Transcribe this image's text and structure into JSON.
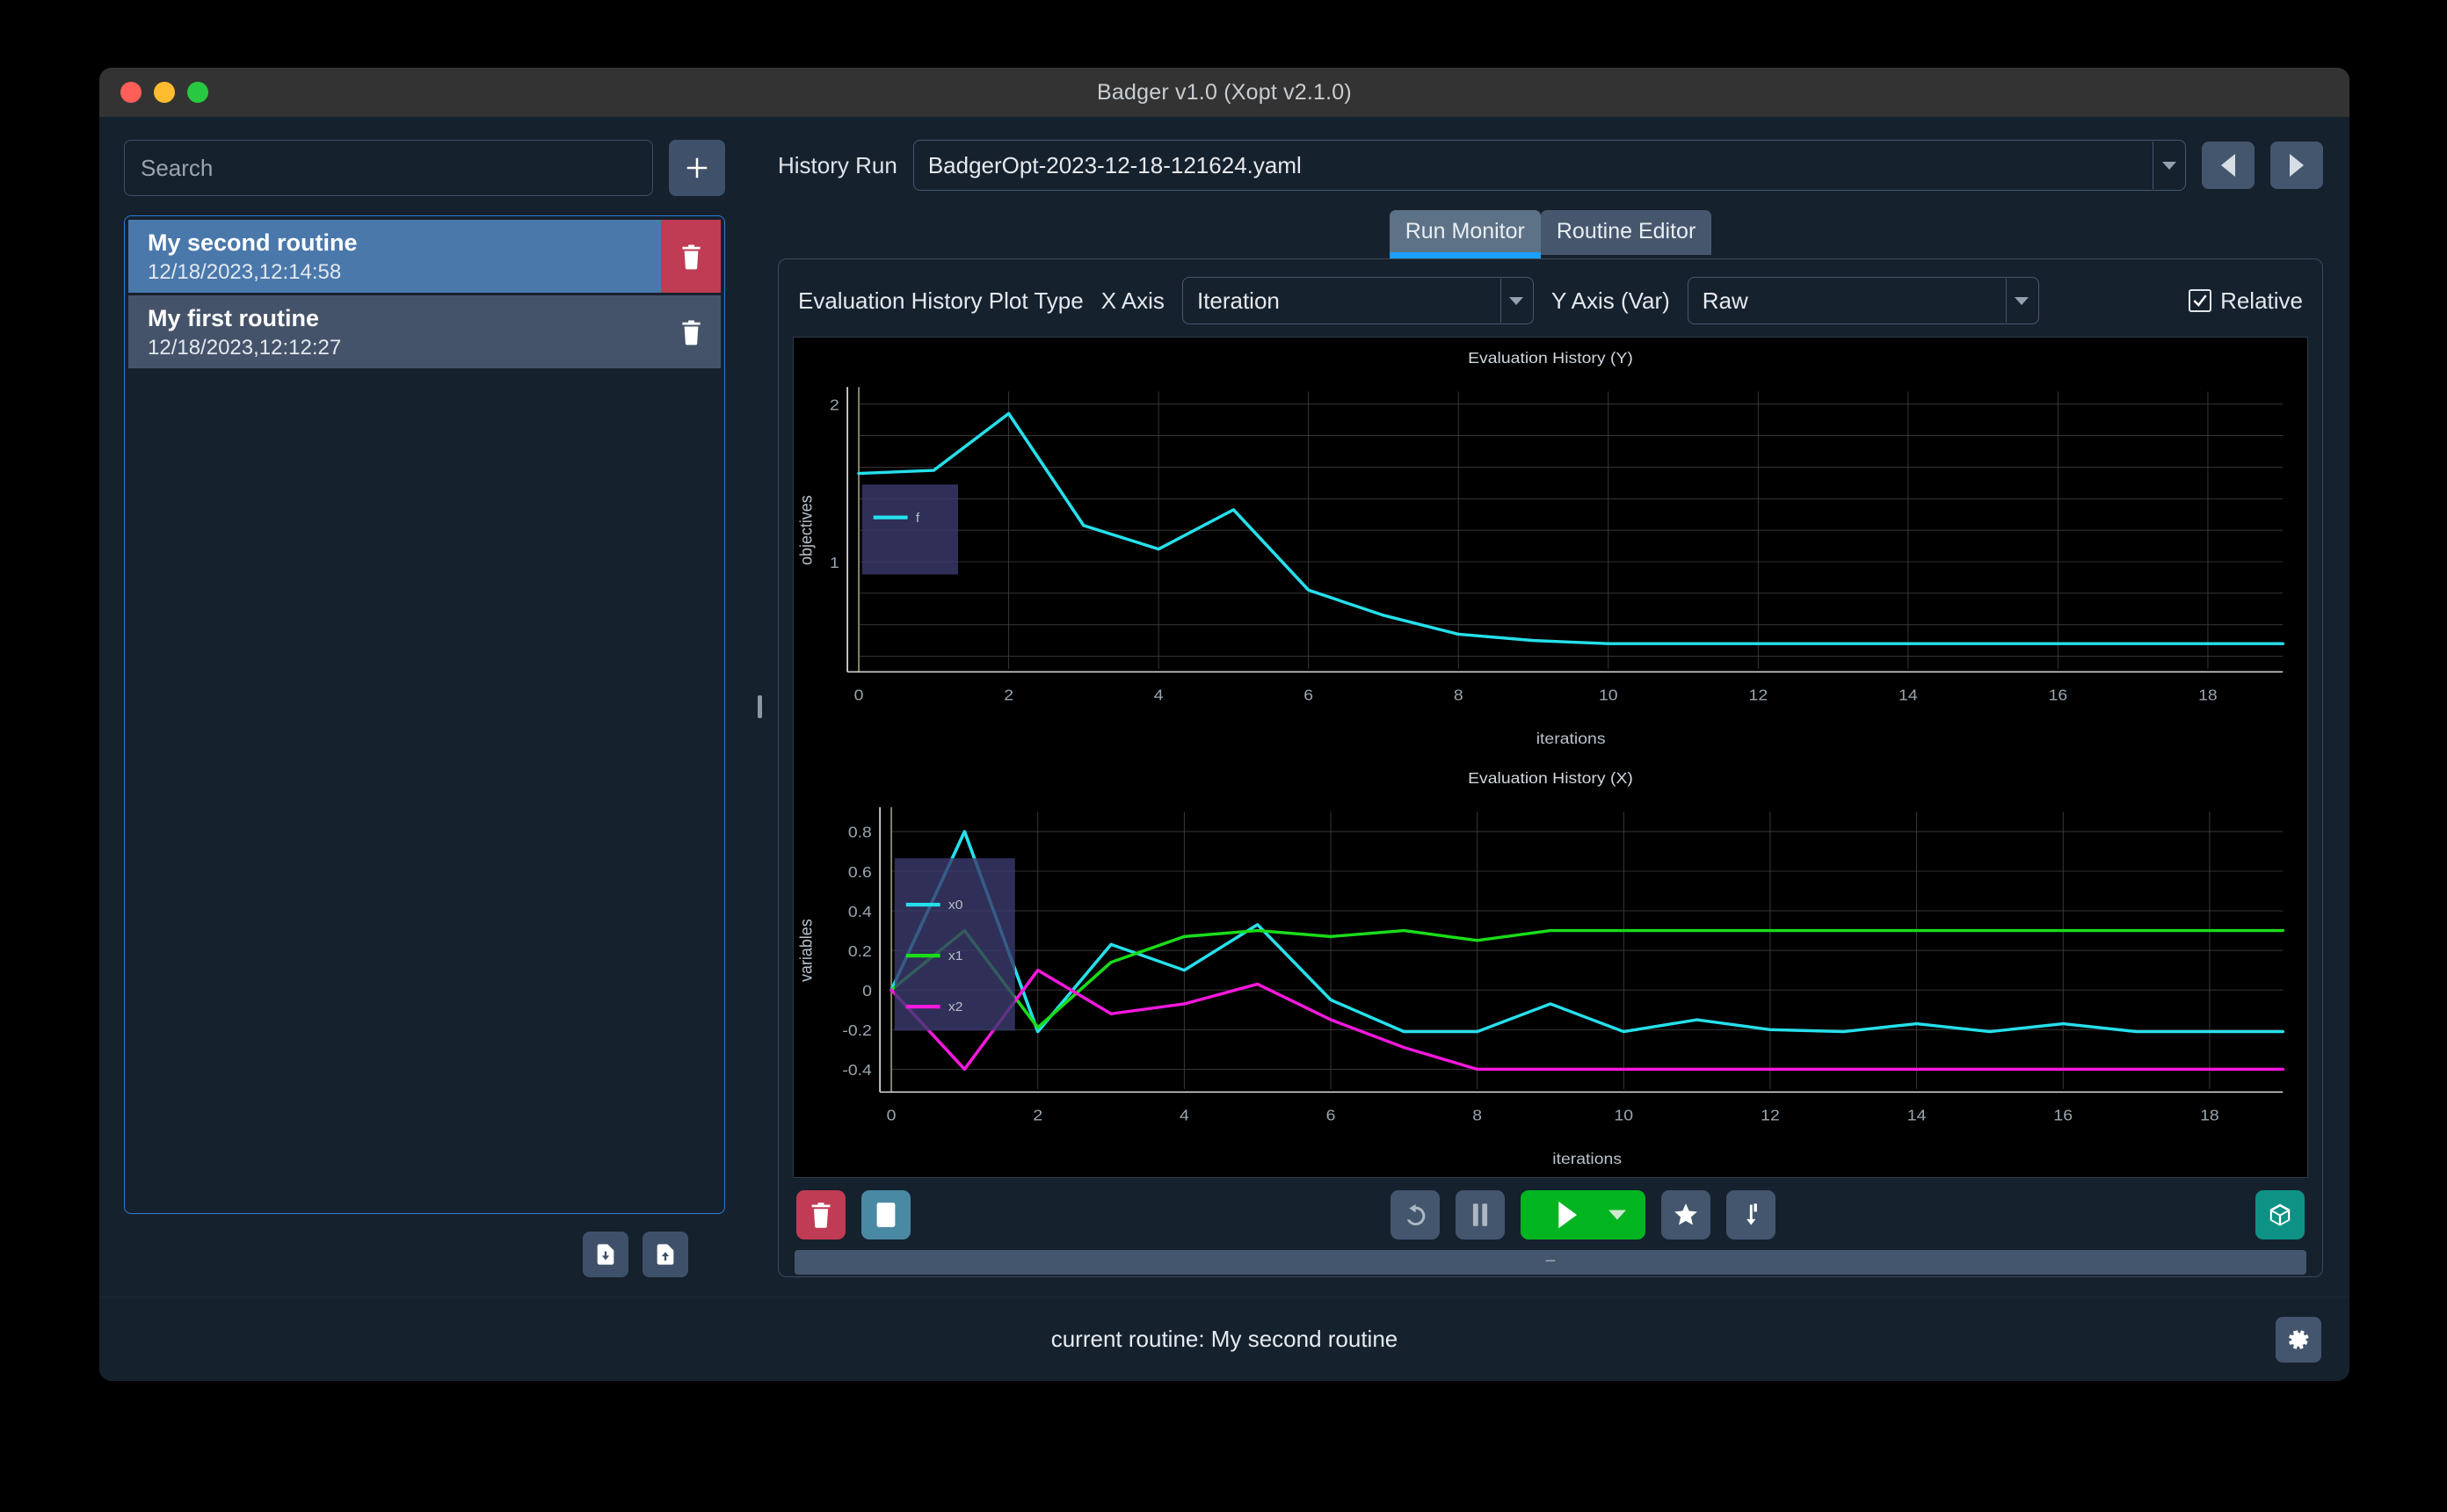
{
  "window": {
    "title": "Badger v1.0 (Xopt v2.1.0)",
    "traffic_lights": [
      "close-red",
      "minimize-yellow",
      "maximize-green"
    ]
  },
  "sidebar": {
    "search": {
      "placeholder": "Search",
      "value": ""
    },
    "add_button_icon": "plus-icon",
    "routines": [
      {
        "name": "My second routine",
        "date": "12/18/2023,12:14:58",
        "selected": true,
        "delete_icon": "trash-icon"
      },
      {
        "name": "My first routine",
        "date": "12/18/2023,12:12:27",
        "selected": false,
        "delete_icon": "trash-icon"
      }
    ],
    "footer": {
      "import_icon": "file-download-icon",
      "export_icon": "file-upload-icon"
    }
  },
  "header": {
    "history_run_label": "History Run",
    "history_run_value": "BadgerOpt-2023-12-18-121624.yaml",
    "prev_icon": "triangle-left-icon",
    "next_icon": "triangle-right-icon"
  },
  "tabs": [
    {
      "label": "Run Monitor",
      "active": true
    },
    {
      "label": "Routine Editor",
      "active": false
    }
  ],
  "plot_controls": {
    "plot_type_label": "Evaluation History Plot Type",
    "x_axis_label": "X Axis",
    "x_axis_value": "Iteration",
    "y_axis_label": "Y Axis (Var)",
    "y_axis_value": "Raw",
    "relative_label": "Relative",
    "relative_checked": true
  },
  "toolbar": {
    "delete_icon": "trash-icon",
    "log_icon": "document-icon",
    "reset_icon": "undo-arrow-icon",
    "pause_icon": "pause-icon",
    "run_icon": "play-icon",
    "run_dropdown_icon": "caret-down-icon",
    "favorite_icon": "star-icon",
    "jump_icon": "arrow-down-into-icon",
    "package_icon": "cube-icon",
    "accent_green": "#00b520",
    "accent_red": "#c03b54",
    "accent_blue": "#4a89a4",
    "accent_teal": "#0f9286"
  },
  "statusbar": {
    "text": "current routine: My second routine",
    "settings_icon": "gear-icon"
  },
  "chart_data": [
    {
      "type": "line",
      "title": "Evaluation History (Y)",
      "xlabel": "iterations",
      "ylabel": "objectives",
      "xlim": [
        0,
        19
      ],
      "ylim": [
        0.32,
        2.08
      ],
      "xticks": [
        0,
        2,
        4,
        6,
        8,
        10,
        12,
        14,
        16,
        18
      ],
      "yticks": [
        1,
        2
      ],
      "grid": true,
      "legend": {
        "position": "top-left",
        "entries": [
          "f"
        ]
      },
      "x": [
        0,
        1,
        2,
        3,
        4,
        5,
        6,
        7,
        8,
        9,
        10,
        11,
        12,
        13,
        14,
        15,
        16,
        17,
        18,
        19
      ],
      "series": [
        {
          "name": "f",
          "color": "#25e0ec",
          "values": [
            1.56,
            1.58,
            1.94,
            1.23,
            1.08,
            1.33,
            0.82,
            0.66,
            0.54,
            0.5,
            0.48,
            0.48,
            0.48,
            0.48,
            0.48,
            0.48,
            0.48,
            0.48,
            0.48,
            0.48
          ]
        }
      ]
    },
    {
      "type": "line",
      "title": "Evaluation History (X)",
      "xlabel": "iterations",
      "ylabel": "variables",
      "xlim": [
        0,
        19
      ],
      "ylim": [
        -0.5,
        0.9
      ],
      "xticks": [
        0,
        2,
        4,
        6,
        8,
        10,
        12,
        14,
        16,
        18
      ],
      "yticks": [
        -0.4,
        -0.2,
        0,
        0.2,
        0.4,
        0.6,
        0.8
      ],
      "grid": true,
      "legend": {
        "position": "top-left",
        "entries": [
          "x0",
          "x1",
          "x2"
        ]
      },
      "x": [
        0,
        1,
        2,
        3,
        4,
        5,
        6,
        7,
        8,
        9,
        10,
        11,
        12,
        13,
        14,
        15,
        16,
        17,
        18,
        19
      ],
      "series": [
        {
          "name": "x0",
          "color": "#25e0ec",
          "values": [
            0.0,
            0.8,
            -0.21,
            0.23,
            0.1,
            0.33,
            -0.05,
            -0.21,
            -0.21,
            -0.07,
            -0.21,
            -0.15,
            -0.2,
            -0.21,
            -0.17,
            -0.21,
            -0.17,
            -0.21,
            -0.21,
            -0.21
          ]
        },
        {
          "name": "x1",
          "color": "#19dd19",
          "values": [
            0.0,
            0.3,
            -0.19,
            0.14,
            0.27,
            0.3,
            0.27,
            0.3,
            0.25,
            0.3,
            0.3,
            0.3,
            0.3,
            0.3,
            0.3,
            0.3,
            0.3,
            0.3,
            0.3,
            0.3
          ]
        },
        {
          "name": "x2",
          "color": "#f618dd",
          "values": [
            0.0,
            -0.4,
            0.1,
            -0.12,
            -0.07,
            0.03,
            -0.15,
            -0.29,
            -0.4,
            -0.4,
            -0.4,
            -0.4,
            -0.4,
            -0.4,
            -0.4,
            -0.4,
            -0.4,
            -0.4,
            -0.4,
            -0.4
          ]
        }
      ]
    }
  ]
}
